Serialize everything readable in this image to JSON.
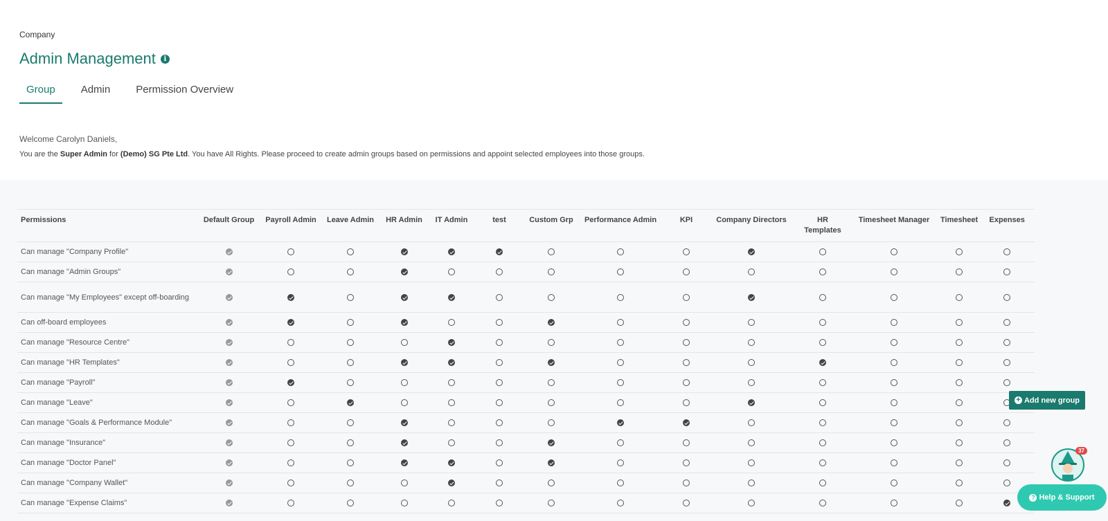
{
  "breadcrumb": "Company",
  "title": "Admin Management",
  "tabs": [
    {
      "label": "Group",
      "active": true
    },
    {
      "label": "Admin",
      "active": false
    },
    {
      "label": "Permission Overview",
      "active": false
    }
  ],
  "welcome": "Welcome Carolyn Daniels,",
  "description": {
    "prefix": "You are the ",
    "role": "Super Admin",
    "middle": " for ",
    "company": "(Demo) SG Pte Ltd",
    "suffix": ". You have All Rights. Please proceed to create admin groups based on permissions and appoint selected employees into those groups."
  },
  "table": {
    "columns": [
      {
        "label": "Permissions"
      },
      {
        "label": "Default Group"
      },
      {
        "label": "Payroll Admin"
      },
      {
        "label": "Leave Admin"
      },
      {
        "label": "HR Admin"
      },
      {
        "label": "IT Admin"
      },
      {
        "label": "test"
      },
      {
        "label": "Custom Grp"
      },
      {
        "label": "Performance Admin"
      },
      {
        "label": "KPI"
      },
      {
        "label": "Company Directors"
      },
      {
        "label": "HR Templates"
      },
      {
        "label": "Timesheet Manager"
      },
      {
        "label": "Timesheet"
      },
      {
        "label": "Expenses"
      }
    ],
    "rows": [
      {
        "label": "Can manage \"Company Profile\"",
        "values": [
          1,
          0,
          0,
          1,
          1,
          1,
          0,
          0,
          0,
          1,
          0,
          0,
          0,
          0
        ]
      },
      {
        "label": "Can manage \"Admin Groups\"",
        "values": [
          1,
          0,
          0,
          1,
          0,
          0,
          0,
          0,
          0,
          0,
          0,
          0,
          0,
          0
        ]
      },
      {
        "label": "Can manage \"My Employees\" except off-boarding",
        "values": [
          1,
          1,
          0,
          1,
          1,
          0,
          0,
          0,
          0,
          1,
          0,
          0,
          0,
          0
        ]
      },
      {
        "label": "Can off-board employees",
        "values": [
          1,
          1,
          0,
          1,
          0,
          0,
          1,
          0,
          0,
          0,
          0,
          0,
          0,
          0
        ]
      },
      {
        "label": "Can manage \"Resource Centre\"",
        "values": [
          1,
          0,
          0,
          0,
          1,
          0,
          0,
          0,
          0,
          0,
          0,
          0,
          0,
          0
        ]
      },
      {
        "label": "Can manage \"HR Templates\"",
        "values": [
          1,
          0,
          0,
          1,
          1,
          0,
          1,
          0,
          0,
          0,
          1,
          0,
          0,
          0
        ]
      },
      {
        "label": "Can manage \"Payroll\"",
        "values": [
          1,
          1,
          0,
          0,
          0,
          0,
          0,
          0,
          0,
          0,
          0,
          0,
          0,
          0
        ]
      },
      {
        "label": "Can manage \"Leave\"",
        "values": [
          1,
          0,
          1,
          0,
          0,
          0,
          0,
          0,
          0,
          1,
          0,
          0,
          0,
          0
        ]
      },
      {
        "label": "Can manage \"Goals & Performance Module\"",
        "values": [
          1,
          0,
          0,
          1,
          0,
          0,
          0,
          1,
          1,
          0,
          0,
          0,
          0,
          0
        ]
      },
      {
        "label": "Can manage \"Insurance\"",
        "values": [
          1,
          0,
          0,
          1,
          0,
          0,
          1,
          0,
          0,
          0,
          0,
          0,
          0,
          0
        ]
      },
      {
        "label": "Can manage \"Doctor Panel\"",
        "values": [
          1,
          0,
          0,
          1,
          1,
          0,
          1,
          0,
          0,
          0,
          0,
          0,
          0,
          0
        ]
      },
      {
        "label": "Can manage \"Company Wallet\"",
        "values": [
          1,
          0,
          0,
          0,
          1,
          0,
          0,
          0,
          0,
          0,
          0,
          0,
          0,
          0
        ]
      },
      {
        "label": "Can manage \"Expense Claims\"",
        "values": [
          1,
          0,
          0,
          0,
          0,
          0,
          0,
          0,
          0,
          0,
          0,
          0,
          0,
          1
        ]
      }
    ]
  },
  "add_group_label": "Add new group",
  "help_label": "Help & Support",
  "notification_count": "37"
}
